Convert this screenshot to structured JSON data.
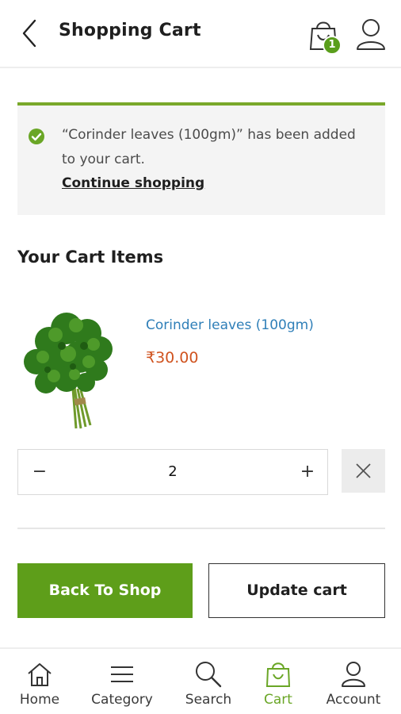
{
  "header": {
    "title": "Shopping Cart",
    "cart_count": "1",
    "back_icon": "chevron-left-icon",
    "cart_icon": "shopping-bag-icon",
    "user_icon": "user-icon"
  },
  "notice": {
    "message": "“Corinder leaves (100gm)” has been added to your cart.",
    "link_text": "Continue shopping",
    "icon": "check-circle-icon",
    "accent_color": "#79a82a"
  },
  "cart": {
    "section_title": "Your Cart Items",
    "items": [
      {
        "name": "Corinder leaves (100gm)",
        "price": "₹30.00",
        "quantity": "2",
        "minus_label": "−",
        "plus_label": "+",
        "image": "coriander-leaves-image",
        "remove_icon": "close-icon"
      }
    ]
  },
  "actions": {
    "back_to_shop": "Back To Shop",
    "update_cart": "Update cart",
    "primary_color": "#5e9e1a"
  },
  "bottom_nav": {
    "active_color": "#6aa626",
    "items": [
      {
        "label": "Home",
        "icon": "home-icon"
      },
      {
        "label": "Category",
        "icon": "menu-icon"
      },
      {
        "label": "Search",
        "icon": "search-icon"
      },
      {
        "label": "Cart",
        "icon": "cart-bag-icon",
        "active": true
      },
      {
        "label": "Account",
        "icon": "account-icon"
      }
    ]
  }
}
